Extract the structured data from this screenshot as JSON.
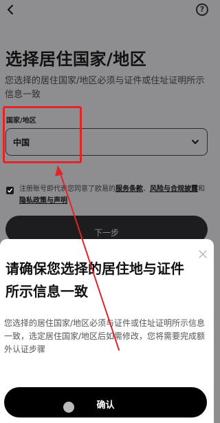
{
  "header": {
    "back_icon": "chevron-left-icon",
    "help_label": "?"
  },
  "page": {
    "title": "选择居住国家/地区",
    "description": "您选择的居住国家/地区必须与证件或住址证明所示信息一致",
    "field_label": "国家/地区",
    "selected_country": "中国",
    "agreement": {
      "prefix": "注册账号即代表您同意了欧易的",
      "terms": "服务条款",
      "separator": "、",
      "risk": "风险与合规披露",
      "and": "和",
      "privacy": "隐私政策与声明"
    },
    "next_label": "下一步"
  },
  "sheet": {
    "title": "请确保您选择的居住地与证件所示信息一致",
    "description": "您选择的居住国家/地区必须与证件或住址证明所示信息一致，选定居住国家/地区后如需修改，您将需要完成额外认证步骤",
    "confirm_label": "确认"
  },
  "colors": {
    "annotation_red": "#e0242a",
    "overlay_gray": "#8e8e91",
    "button_black": "#000000"
  }
}
